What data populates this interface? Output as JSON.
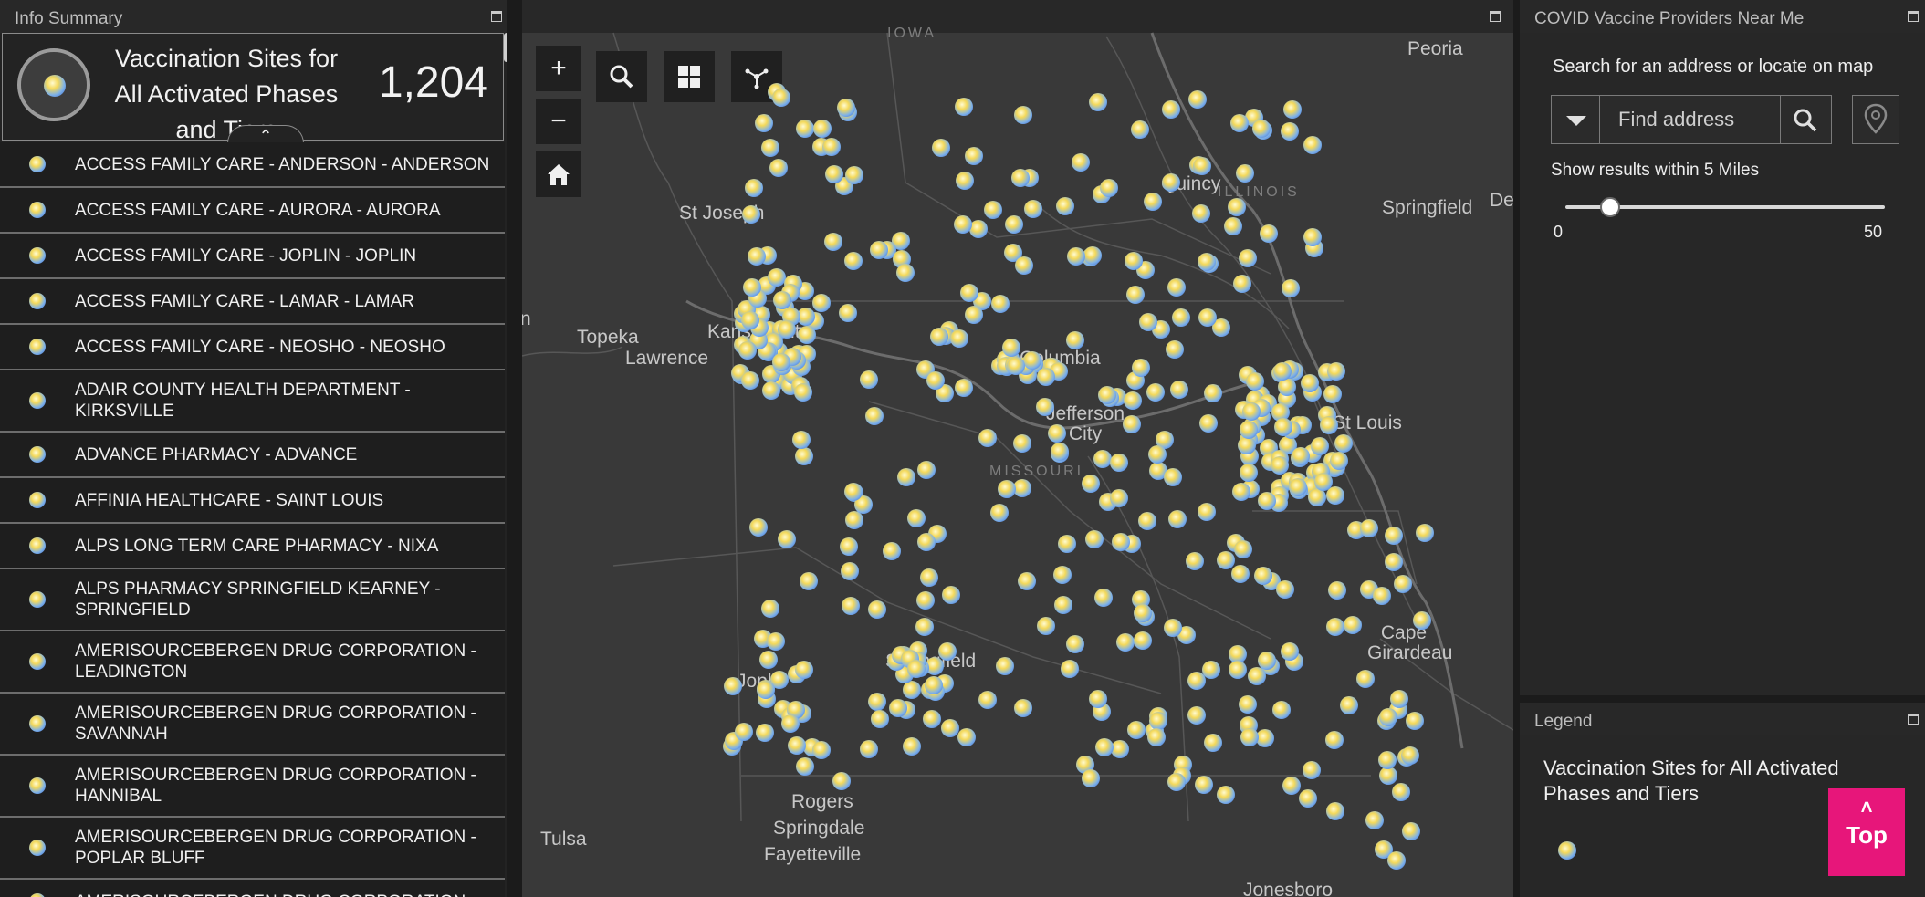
{
  "info_summary": {
    "panel_title": "Info Summary",
    "layer_title": "Vaccination Sites for All Activated Phases and Tiers",
    "count": "1,204"
  },
  "sites": [
    "ACCESS FAMILY CARE - ANDERSON - ANDERSON",
    "ACCESS FAMILY CARE - AURORA - AURORA",
    "ACCESS FAMILY CARE - JOPLIN - JOPLIN",
    "ACCESS FAMILY CARE - LAMAR - LAMAR",
    "ACCESS FAMILY CARE - NEOSHO - NEOSHO",
    "ADAIR COUNTY HEALTH DEPARTMENT - KIRKSVILLE",
    "ADVANCE PHARMACY - ADVANCE",
    "AFFINIA HEALTHCARE - SAINT LOUIS",
    "ALPS LONG TERM CARE PHARMACY - NIXA",
    "ALPS PHARMACY SPRINGFIELD KEARNEY - SPRINGFIELD",
    "AMERISOURCEBERGEN DRUG CORPORATION - LEADINGTON",
    "AMERISOURCEBERGEN DRUG CORPORATION - SAVANNAH",
    "AMERISOURCEBERGEN DRUG CORPORATION - HANNIBAL",
    "AMERISOURCEBERGEN DRUG CORPORATION - POPLAR BLUFF",
    "AMERISOURCEBERGEN DRUG CORPORATION -"
  ],
  "map": {
    "cities": [
      "Peoria",
      "St Joseph",
      "Quincy",
      "Springfield",
      "Topeka",
      "Kansas City",
      "Lawrence",
      "Columbia",
      "Jefferson City",
      "St Louis",
      "Springfield",
      "Joplin",
      "Cape Girardeau",
      "Rogers",
      "Springdale",
      "Fayetteville",
      "Tulsa",
      "Jonesboro",
      "De"
    ],
    "states": [
      "IOWA",
      "ILLINOIS",
      "MISSOURI"
    ],
    "controls": [
      "zoom-in",
      "zoom-out",
      "home",
      "search",
      "basemap",
      "share"
    ]
  },
  "search": {
    "panel_title": "COVID Vaccine Providers Near Me",
    "help": "Search for an address or locate on map",
    "placeholder": "Find address",
    "within_label": "Show results within 5 Miles",
    "slider_min": "0",
    "slider_max": "50",
    "slider_value": 5
  },
  "legend": {
    "panel_title": "Legend",
    "layer_title": "Vaccination Sites for All Activated Phases and Tiers"
  },
  "top_button": "Top",
  "colors": {
    "accent": "#e7167a",
    "panel": "#272727",
    "map": "#393939"
  }
}
